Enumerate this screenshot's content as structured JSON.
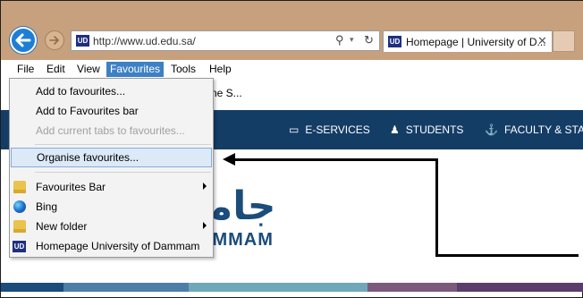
{
  "browser": {
    "address_url": "http://www.ud.edu.sa/",
    "tab_title": "Homepage | University of D...",
    "favicon_text": "UD",
    "search_glyph": "⚲",
    "dropdown_glyph": "▾",
    "refresh_glyph": "↻",
    "close_glyph": "✕",
    "back_glyph": "←",
    "forward_glyph": "→"
  },
  "menubar": {
    "items": [
      {
        "label": "File"
      },
      {
        "label": "Edit"
      },
      {
        "label": "View"
      },
      {
        "label": "Favourites",
        "active": true
      },
      {
        "label": "Tools"
      },
      {
        "label": "Help"
      }
    ]
  },
  "favourites_bar": {
    "partial_text": "ne S..."
  },
  "favourites_menu": {
    "items": [
      {
        "label": "Add to favourites...",
        "icon": "none"
      },
      {
        "label": "Add to Favourites bar",
        "icon": "none"
      },
      {
        "label": "Add current tabs to favourites...",
        "icon": "none",
        "disabled": true
      },
      {
        "label": "Organise favourites...",
        "icon": "none",
        "highlighted": true
      },
      {
        "label": "Favourites Bar",
        "icon": "folder-icon",
        "submenu": true
      },
      {
        "label": "Bing",
        "icon": "bing-icon"
      },
      {
        "label": "New folder",
        "icon": "folder-icon",
        "submenu": true
      },
      {
        "label": "Homepage  University of Dammam",
        "icon": "ud-favicon-icon"
      }
    ]
  },
  "site_nav": {
    "items": [
      {
        "label": "E-SERVICES",
        "icon": "monitor-icon"
      },
      {
        "label": "STUDENTS",
        "icon": "person-icon"
      },
      {
        "label": "FACULTY & STAFF",
        "icon": "anchor-icon"
      }
    ],
    "icon_glyphs": {
      "monitor": "▭",
      "person": "♟",
      "anchor": "⚓"
    }
  },
  "site_logo": {
    "arabic": "جامـ",
    "latin": "AMMAM"
  },
  "colors": {
    "titlebar": "#c7a07d",
    "menu_active": "#3d80c4",
    "site_nav": "#143d66",
    "highlight": "#dce9f7",
    "logo": "#1a4c7c"
  }
}
